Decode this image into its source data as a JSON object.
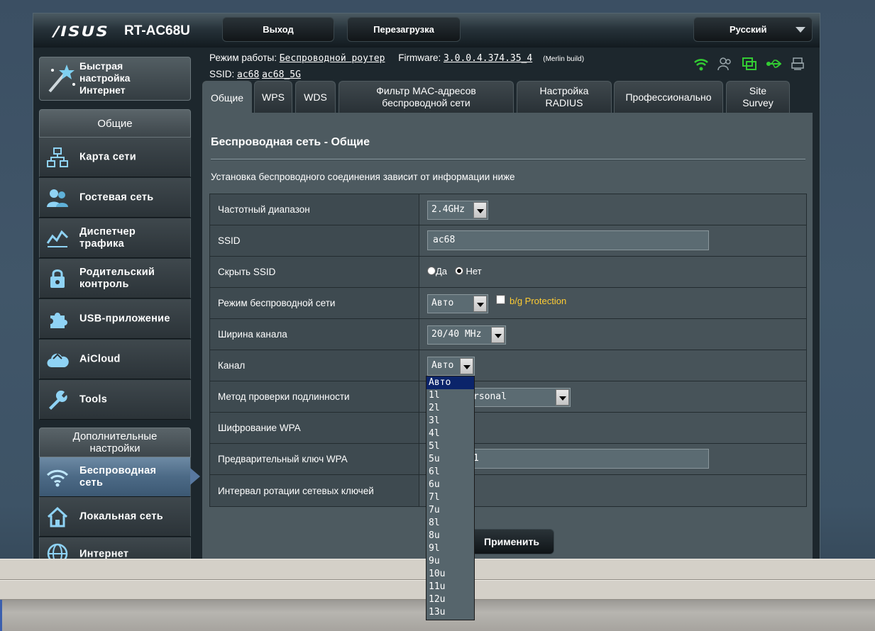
{
  "header": {
    "brand": "/ISUS",
    "model": "RT-AC68U",
    "logout_label": "Выход",
    "reboot_label": "Перезагрузка",
    "language_label": "Русский"
  },
  "quick_setup": {
    "label_line1": "Быстрая",
    "label_line2": "настройка",
    "label_line3": "Интернет"
  },
  "sidebar": {
    "general_title": "Общие",
    "general_items": [
      {
        "label": "Карта сети",
        "icon": "network-map-icon"
      },
      {
        "label": "Гостевая сеть",
        "icon": "guest-network-icon"
      },
      {
        "label_line1": "Диспетчер",
        "label_line2": "трафика",
        "icon": "traffic-manager-icon"
      },
      {
        "label_line1": "Родительский",
        "label_line2": "контроль",
        "icon": "parental-control-icon"
      },
      {
        "label": "USB-приложение",
        "icon": "usb-app-icon"
      },
      {
        "label": "AiCloud",
        "icon": "aicloud-icon"
      },
      {
        "label": "Tools",
        "icon": "tools-icon"
      }
    ],
    "advanced_title_line1": "Дополнительные",
    "advanced_title_line2": "настройки",
    "advanced_items": [
      {
        "label_line1": "Беспроводная",
        "label_line2": "сеть",
        "icon": "wireless-icon",
        "active": true
      },
      {
        "label": "Локальная сеть",
        "icon": "lan-icon"
      },
      {
        "label": "Интернет",
        "icon": "internet-icon"
      }
    ]
  },
  "info": {
    "mode_label": "Режим работы:",
    "mode_value": "Беспроводной роутер",
    "firmware_label": "Firmware:",
    "firmware_value": "3.0.0.4.374.35_4",
    "firmware_note": "(Merlin build)",
    "ssid_label": "SSID:",
    "ssid_values": [
      "ac68",
      "ac68_5G"
    ]
  },
  "tabs": [
    {
      "label": "Общие",
      "active": true
    },
    {
      "label": "WPS"
    },
    {
      "label": "WDS"
    },
    {
      "label_line1": "Фильтр MAC-адресов",
      "label_line2": "беспроводной сети"
    },
    {
      "label_line1": "Настройка",
      "label_line2": "RADIUS"
    },
    {
      "label": "Профессионально"
    },
    {
      "label_line1": "Site",
      "label_line2": "Survey"
    }
  ],
  "main": {
    "title": "Беспроводная сеть - Общие",
    "description": "Установка беспроводного соединения зависит от информации ниже",
    "fields": {
      "band": {
        "label": "Частотный диапазон",
        "value": "2.4GHz"
      },
      "ssid": {
        "label": "SSID",
        "value": "ac68"
      },
      "hide_ssid": {
        "label": "Скрыть SSID",
        "option_yes": "Да",
        "option_no": "Нет",
        "selected": "Нет"
      },
      "wireless_mode": {
        "label": "Режим беспроводной сети",
        "value": "Авто",
        "checkbox_label": "b/g Protection"
      },
      "channel_width": {
        "label": "Ширина канала",
        "value": "20/40 MHz"
      },
      "channel": {
        "label": "Канал",
        "value": "Авто"
      },
      "auth_method": {
        "label": "Метод проверки подлинности",
        "value_visible": "rsonal"
      },
      "wpa_encryption": {
        "label": "Шифрование WPA"
      },
      "wpa_key": {
        "label": "Предварительный ключ WPA",
        "value_visible": "1"
      },
      "key_rotation": {
        "label": "Интервал ротации сетевых ключей"
      }
    },
    "apply_label": "Применить"
  },
  "channel_dropdown": {
    "options": [
      "Авто",
      "1l",
      "2l",
      "3l",
      "4l",
      "5l",
      "5u",
      "6l",
      "6u",
      "7l",
      "7u",
      "8l",
      "8u",
      "9l",
      "9u",
      "10u",
      "11u",
      "12u",
      "13u"
    ],
    "highlighted": "Авто"
  },
  "colors": {
    "accent_yellow": "#ffcc33",
    "status_green": "#33cc33",
    "selection_blue": "#0b246a"
  }
}
